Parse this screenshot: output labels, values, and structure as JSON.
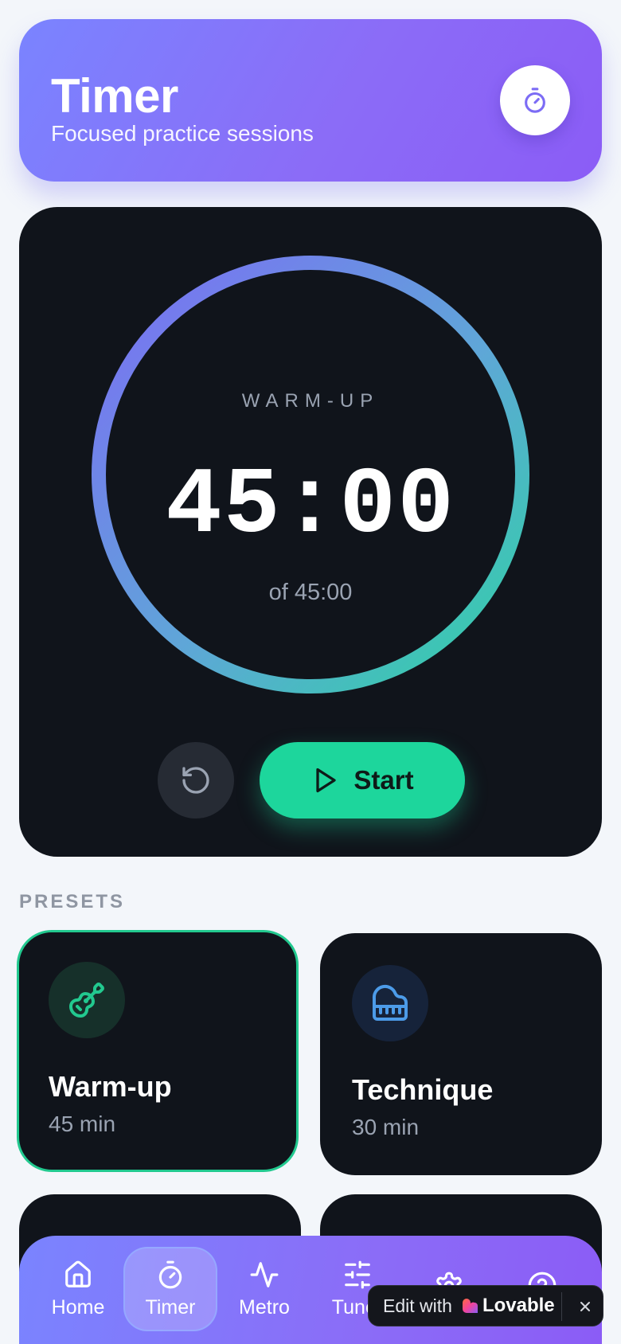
{
  "header": {
    "title": "Timer",
    "subtitle": "Focused practice sessions",
    "icon": "stopwatch-icon"
  },
  "timer": {
    "session_label": "WARM-UP",
    "time": "45:00",
    "total": "of 45:00",
    "progress": 1.0,
    "reset_icon": "rotate-ccw-icon",
    "start_label": "Start",
    "start_icon": "play-icon"
  },
  "presets": {
    "heading": "PRESETS",
    "items": [
      {
        "name": "Warm-up",
        "duration": "45 min",
        "icon": "guitar-icon",
        "active": true
      },
      {
        "name": "Technique",
        "duration": "30 min",
        "icon": "piano-icon",
        "active": false
      }
    ]
  },
  "nav": {
    "items": [
      {
        "label": "Home",
        "icon": "home-icon"
      },
      {
        "label": "Timer",
        "icon": "stopwatch-icon",
        "active": true
      },
      {
        "label": "Metro",
        "icon": "activity-icon"
      },
      {
        "label": "Tuner",
        "icon": "sliders-icon"
      },
      {
        "label": "",
        "icon": "gear-icon"
      },
      {
        "label": "",
        "icon": "help-circle-icon"
      }
    ]
  },
  "badge": {
    "edit_text": "Edit with",
    "brand": "Lovable"
  },
  "colors": {
    "accent_green": "#1dd69c",
    "accent_purple": "#8b5cf6",
    "accent_blue": "#7a84ff",
    "card_dark": "#10141b"
  }
}
